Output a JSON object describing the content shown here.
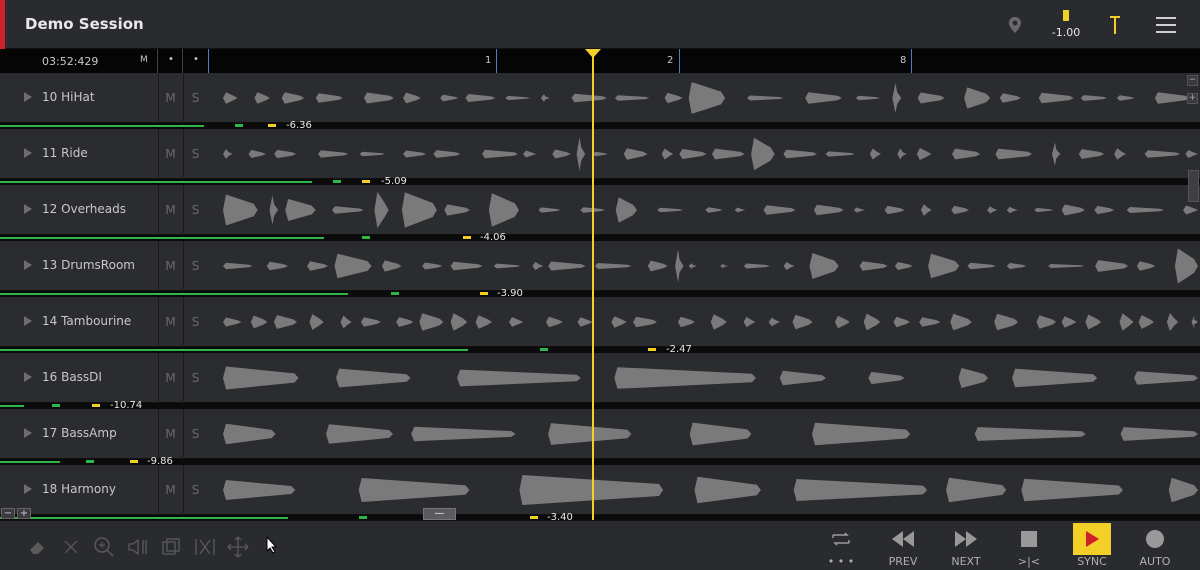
{
  "session": {
    "title": "Demo Session"
  },
  "header": {
    "marker_icon": "map-pin-icon",
    "meter_value": "-1.00",
    "pin_icon": "playhead-pin-icon",
    "menu_icon": "hamburger-menu-icon",
    "accent_color": "#f2d028",
    "record_color": "#d0202a"
  },
  "ruler": {
    "timecode": "03:52:429",
    "m_label": "M",
    "dot1": "•",
    "dot2": "•",
    "markers": [
      "1",
      "2",
      "8"
    ]
  },
  "tracks": [
    {
      "num": "10",
      "name": "HiHat",
      "mute": "M",
      "solo": "S",
      "peak": "-6.36",
      "level": 0.17
    },
    {
      "num": "11",
      "name": "Ride",
      "mute": "M",
      "solo": "S",
      "peak": "-5.09",
      "level": 0.26
    },
    {
      "num": "12",
      "name": "Overheads",
      "mute": "M",
      "solo": "S",
      "peak": "-4.06",
      "level": 0.27
    },
    {
      "num": "13",
      "name": "DrumsRoom",
      "mute": "M",
      "solo": "S",
      "peak": "-3.90",
      "level": 0.29
    },
    {
      "num": "14",
      "name": "Tambourine",
      "mute": "M",
      "solo": "S",
      "peak": "-2.47",
      "level": 0.39
    },
    {
      "num": "16",
      "name": "BassDI",
      "mute": "M",
      "solo": "S",
      "peak": "-10.74",
      "level": 0.02
    },
    {
      "num": "17",
      "name": "BassAmp",
      "mute": "M",
      "solo": "S",
      "peak": "-9.86",
      "level": 0.05
    },
    {
      "num": "18",
      "name": "Harmony",
      "mute": "M",
      "solo": "S",
      "peak": "-3.40",
      "level": 0.24
    }
  ],
  "zoom": {
    "out": "−",
    "in": "+",
    "hscroll": "—"
  },
  "tools": [
    "eraser-icon",
    "cut-x-icon",
    "zoom-icon",
    "speaker-split-icon",
    "copy-icon",
    "scissors-icon",
    "move-icon"
  ],
  "transport": {
    "loop_label": "• • •",
    "prev_label": "PREV",
    "next_label": "NEXT",
    "stop_label": ">|<",
    "sync_label": "SYNC",
    "auto_label": "AUTO"
  }
}
